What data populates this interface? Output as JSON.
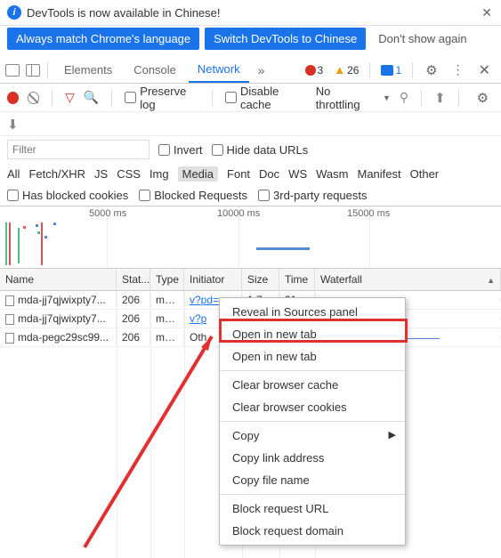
{
  "banner": {
    "message": "DevTools is now available in Chinese!",
    "always_match": "Always match Chrome's language",
    "switch_to": "Switch DevTools to Chinese",
    "dont_show": "Don't show again"
  },
  "tabs": {
    "elements": "Elements",
    "console": "Console",
    "network": "Network"
  },
  "stats": {
    "errors": "3",
    "warnings": "26",
    "messages": "1"
  },
  "toolbar": {
    "preserve_log": "Preserve log",
    "disable_cache": "Disable cache",
    "throttling": "No throttling"
  },
  "filter": {
    "placeholder": "Filter",
    "invert": "Invert",
    "hide_data": "Hide data URLs"
  },
  "types": {
    "all": "All",
    "fetch": "Fetch/XHR",
    "js": "JS",
    "css": "CSS",
    "img": "Img",
    "media": "Media",
    "font": "Font",
    "doc": "Doc",
    "ws": "WS",
    "wasm": "Wasm",
    "manifest": "Manifest",
    "other": "Other"
  },
  "cookies": {
    "blocked": "Has blocked cookies",
    "blocked_req": "Blocked Requests",
    "third_party": "3rd-party requests"
  },
  "timeline": {
    "t1": "5000 ms",
    "t2": "10000 ms",
    "t3": "15000 ms"
  },
  "headers": {
    "name": "Name",
    "status": "Stat...",
    "type": "Type",
    "initiator": "Initiator",
    "size": "Size",
    "time": "Time",
    "waterfall": "Waterfall"
  },
  "rows": [
    {
      "name": "mda-jj7qjwixpty7...",
      "status": "206",
      "type": "me...",
      "initiator": "v?pd=wi...",
      "size": "1.7...",
      "time": "315..."
    },
    {
      "name": "mda-jj7qjwixpty7...",
      "status": "206",
      "type": "me...",
      "initiator": "v?p",
      "size": "",
      "time": ""
    },
    {
      "name": "mda-pegc29sc99...",
      "status": "206",
      "type": "me...",
      "initiator": "Oth",
      "size": "",
      "time": ""
    }
  ],
  "menu": {
    "reveal": "Reveal in Sources panel",
    "open1": "Open in new tab",
    "open2": "Open in new tab",
    "clear_cache": "Clear browser cache",
    "clear_cookies": "Clear browser cookies",
    "copy": "Copy",
    "copy_link": "Copy link address",
    "copy_file": "Copy file name",
    "block_url": "Block request URL",
    "block_domain": "Block request domain"
  }
}
